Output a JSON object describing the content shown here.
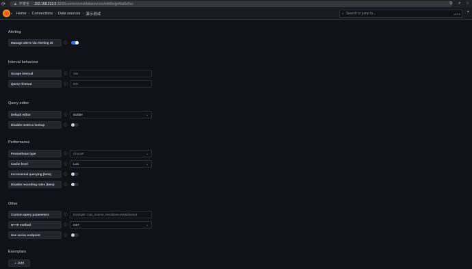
{
  "browser": {
    "security": "不安全",
    "host": "192.168.213.5",
    "path": ":3000/connections/datasources/edit/bejjp4da6o0ez",
    "toolbar_icons": [
      "translate-icon",
      "share-icon",
      "star-icon"
    ]
  },
  "topbar": {
    "breadcrumbs": [
      "Home",
      "Connections",
      "Data sources",
      "演示测试"
    ],
    "search_placeholder": "Search or jump to...",
    "search_shortcut": "ctrl+k",
    "add_label": "+"
  },
  "sections": {
    "alerting": {
      "title": "Alerting",
      "manage_alerts_label": "Manage alerts via Alerting UI",
      "manage_alerts_on": true
    },
    "interval": {
      "title": "Interval behaviour",
      "scrape_label": "Scrape interval",
      "scrape_placeholder": "15s",
      "timeout_label": "Query timeout",
      "timeout_placeholder": "60s"
    },
    "query_editor": {
      "title": "Query editor",
      "default_editor_label": "Default editor",
      "default_editor_value": "Builder",
      "disable_lookup_label": "Disable metrics lookup",
      "disable_lookup_on": false
    },
    "performance": {
      "title": "Performance",
      "prom_type_label": "Prometheus type",
      "prom_type_placeholder": "Choose",
      "cache_label": "Cache level",
      "cache_value": "Low",
      "incremental_label": "Incremental querying (beta)",
      "incremental_on": false,
      "disable_rules_label": "Disable recording rules (beta)",
      "disable_rules_on": false
    },
    "other": {
      "title": "Other",
      "custom_params_label": "Custom query parameters",
      "custom_params_placeholder": "Example: max_source_resolution=5m&timeout",
      "http_method_label": "HTTP method",
      "http_method_value": "GET",
      "series_endpoint_label": "Use series endpoint",
      "series_endpoint_on": false
    },
    "exemplars": {
      "title": "Exemplars",
      "add_label": "Add"
    }
  },
  "colors": {
    "background": "#111217",
    "panel": "#22252b",
    "accent": "#3d71d9",
    "border": "#2a2d33"
  }
}
